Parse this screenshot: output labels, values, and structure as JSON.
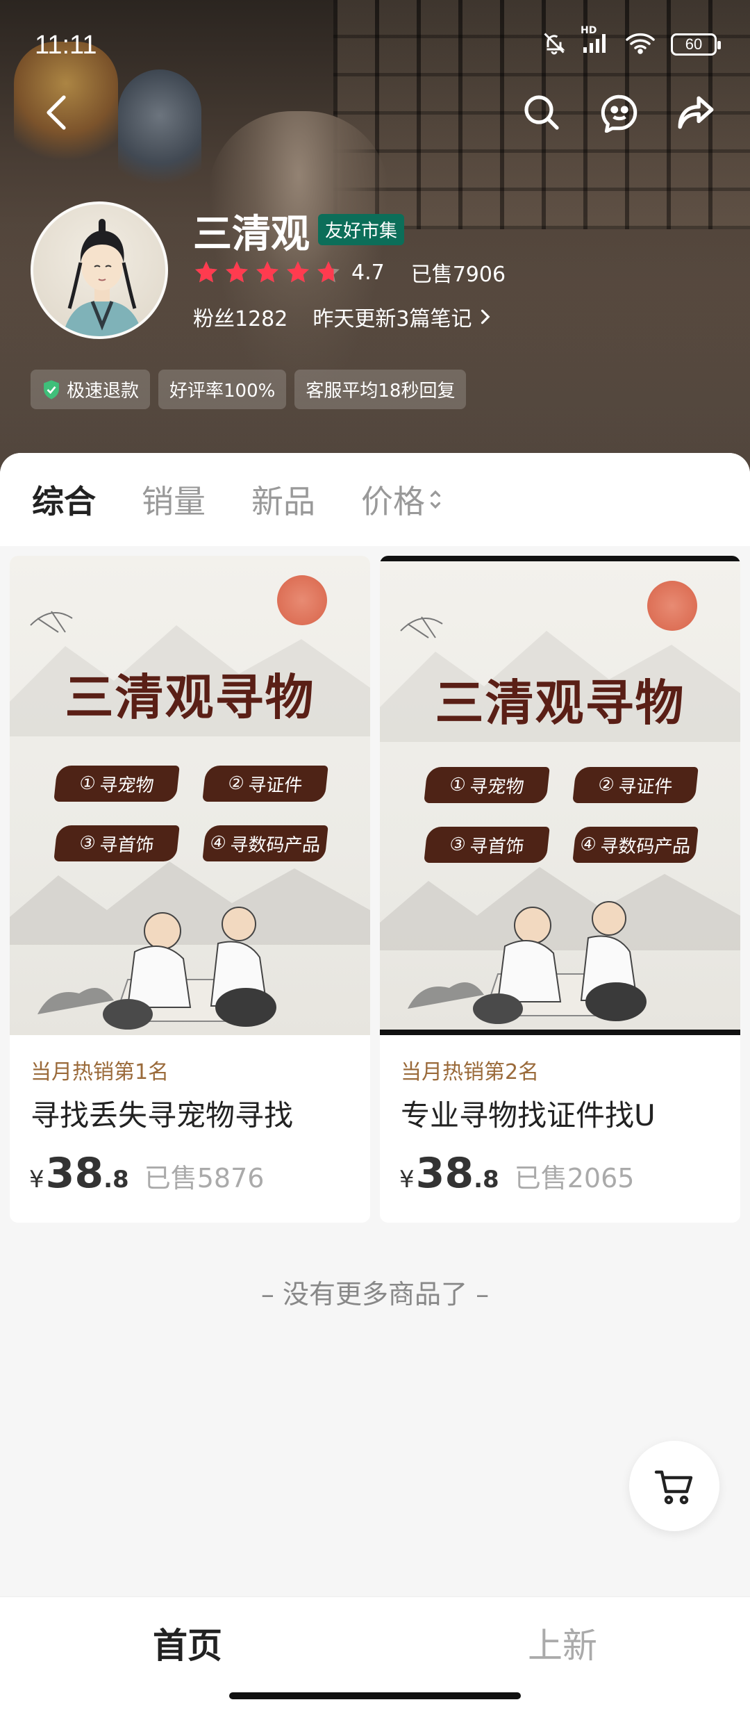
{
  "status": {
    "time": "11:11",
    "battery": "60",
    "hd": "HD"
  },
  "shop": {
    "name": "三清观",
    "badge": "友好市集",
    "rating": "4.7",
    "rating_fraction": 0.94,
    "sold": "已售7906",
    "fans": "粉丝1282",
    "update": "昨天更新3篇笔记",
    "tags": [
      "极速退款",
      "好评率100%",
      "客服平均18秒回复"
    ]
  },
  "tabs": [
    "综合",
    "销量",
    "新品",
    "价格"
  ],
  "products": [
    {
      "poster_title": "三清观寻物",
      "items": [
        "寻宠物",
        "寻证件",
        "寻首饰",
        "寻数码产品"
      ],
      "nums": [
        "①",
        "②",
        "③",
        "④"
      ],
      "rank": "当月热销第1名",
      "title": "寻找丢失寻宠物寻找",
      "yen": "¥",
      "price_int": "38",
      "price_dec": ".8",
      "sold": "已售5876"
    },
    {
      "poster_title": "三清观寻物",
      "items": [
        "寻宠物",
        "寻证件",
        "寻首饰",
        "寻数码产品"
      ],
      "nums": [
        "①",
        "②",
        "③",
        "④"
      ],
      "rank": "当月热销第2名",
      "title": "专业寻物找证件找U",
      "yen": "¥",
      "price_int": "38",
      "price_dec": ".8",
      "sold": "已售2065"
    }
  ],
  "no_more": "– 没有更多商品了 –",
  "bottom_nav": [
    "首页",
    "上新"
  ],
  "colors": {
    "accent_star": "#ff3b4f",
    "badge_green": "#0c6e59",
    "rank_brown": "#9a6a3a"
  },
  "icons": {
    "back": "chevron-left-icon",
    "search": "search-icon",
    "message": "chat-bubble-icon",
    "share": "share-icon",
    "cart": "cart-icon",
    "shield": "shield-check-icon",
    "sort": "sort-updown-icon",
    "arrow": "chevron-right-icon"
  }
}
